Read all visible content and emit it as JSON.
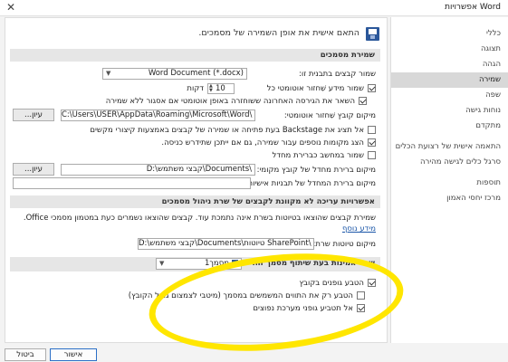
{
  "window": {
    "title": "אפשרויות Word"
  },
  "nav": {
    "items": [
      {
        "label": "כללי"
      },
      {
        "label": "תצוגה"
      },
      {
        "label": "הגהה"
      },
      {
        "label": "שמירה",
        "active": true
      },
      {
        "label": "שפה"
      },
      {
        "label": "נוחות גישה"
      },
      {
        "label": "מתקדם"
      },
      {
        "label": "התאמה אישית של רצועת הכלים"
      },
      {
        "label": "סרגל כלים לגישה מהירה"
      },
      {
        "label": "תוספות"
      },
      {
        "label": "מרכז יחסי האמון"
      }
    ]
  },
  "header": {
    "text": "התאם אישית את אופן השמירה של מסמכים."
  },
  "save_docs": {
    "section_title": "שמירת מסמכים",
    "format_label": "שמור קבצים בתבנית זו:",
    "format_value": "Word Document (*.docx)",
    "autorecover_label": "שמור מידע שִׁחזור אוטומטי כל",
    "autorecover_minutes": "10",
    "minutes_unit": "דקות",
    "keep_last_label": "השאר את הגירסה האחרונה ששוחזרה באופן אוטומטי אם אסגור ללא שמירה",
    "autorecover_location_label": "מיקום קובץ שִׁחזור אוטומטי:",
    "autorecover_location_value": "C:\\Users\\USER\\AppData\\Roaming\\Microsoft\\Word\\",
    "browse_label": "עיון...",
    "backstage_label": "אל תציג את Backstage בעת פתיחה או שמירה של קבצים באמצעות קיצורי מקשים",
    "additional_places_label": "הצג מקומות נוספים עבור שמירה, גם אם ייתכן שתידרש כניסה.",
    "save_computer_label": "שמור במחשב כברירת מחדל",
    "local_file_label": "מיקום ברירת מחדל של קובץ מקומי:",
    "local_file_value": "D:\\קבצי משתמש\\Documents\\",
    "templates_label": "מיקום ברירת המחדל של תבניות אישיות:",
    "templates_value": ""
  },
  "offline": {
    "section_title": "אפשרויות עריכה לא מקוונת לקבצים של שרת ניהול מסמכים",
    "desc_text": "שמירת קבצים שהוצאו בטיוטות בשרת אינה נתמכת עוד. קבצים שהוצאו נשמרים כעת במטמון מסמכי Office.",
    "more_info": "מידע נוסף",
    "drafts_label": "מיקום טיוטות שרת:",
    "drafts_value": "D:\\קבצי משתמש\\Documents\\טיוטות SharePoint\\"
  },
  "fidelity": {
    "section_title": "שמר אמינות בעת שיתוף מסמך זה:",
    "doc_value": "מסמך1",
    "embed_fonts_label": "הטבע גופנים בקובץ",
    "embed_only_used_label": "הטבע רק את התווים המשמשים במסמך (מיטבי לצמצום גודל הקובץ)",
    "no_system_fonts_label": "אל תטביע גופני מערכת נפוצים"
  },
  "footer": {
    "ok": "אישור",
    "cancel": "ביטול"
  },
  "colors": {
    "annotation": "#ffe600",
    "icon": "#2b579a",
    "link": "#1a56a8"
  }
}
